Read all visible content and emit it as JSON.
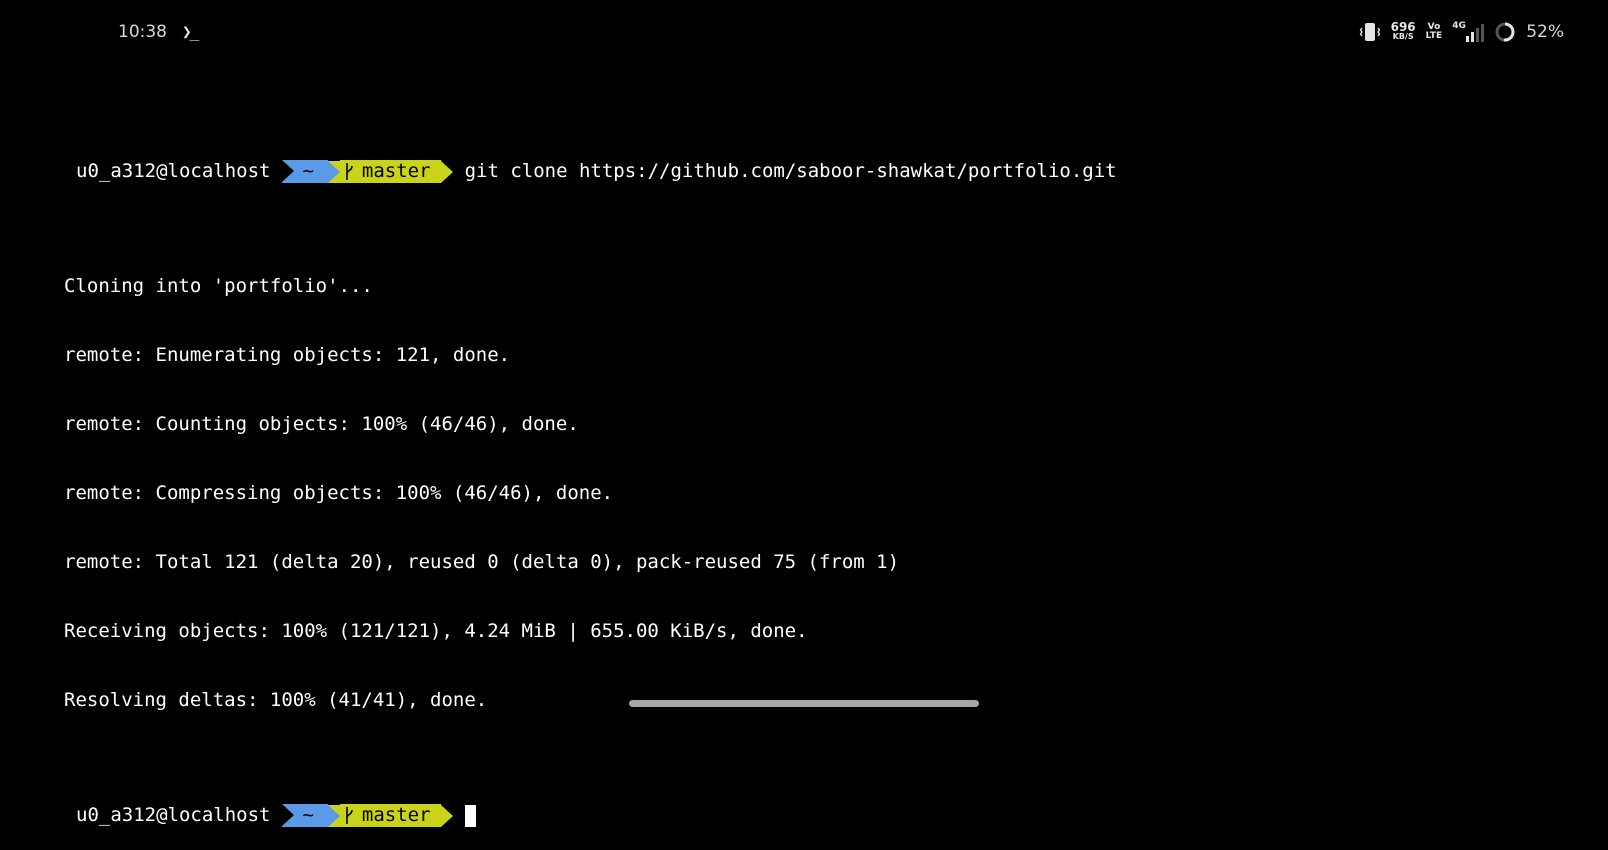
{
  "status_bar": {
    "time": "10:38",
    "app_indicator": "❯_",
    "net_speed_value": "696",
    "net_speed_unit": "KB/S",
    "volte_top": "Vo",
    "volte_bottom": "LTE",
    "network_type": "4G",
    "battery_percent": "52%",
    "battery_level": 0.52,
    "icons": [
      "vibrate-icon",
      "network-speed",
      "volte-icon",
      "signal-icon",
      "battery-ring-icon"
    ]
  },
  "terminal": {
    "prompt": {
      "user_host": "u0_a312@localhost",
      "directory": "~",
      "branch_symbol": "branch-icon",
      "branch": "master"
    },
    "command": "git clone https://github.com/saboor-shawkat/portfolio.git",
    "output_lines": [
      "Cloning into 'portfolio'...",
      "remote: Enumerating objects: 121, done.",
      "remote: Counting objects: 100% (46/46), done.",
      "remote: Compressing objects: 100% (46/46), done.",
      "remote: Total 121 (delta 20), reused 0 (delta 0), pack-reused 75 (from 1)",
      "Receiving objects: 100% (121/121), 4.24 MiB | 655.00 KiB/s, done.",
      "Resolving deltas: 100% (41/41), done."
    ],
    "colors": {
      "dir_segment": "#5b9ae6",
      "branch_segment": "#c9d31a",
      "background": "#000000",
      "text": "#ffffff"
    }
  }
}
